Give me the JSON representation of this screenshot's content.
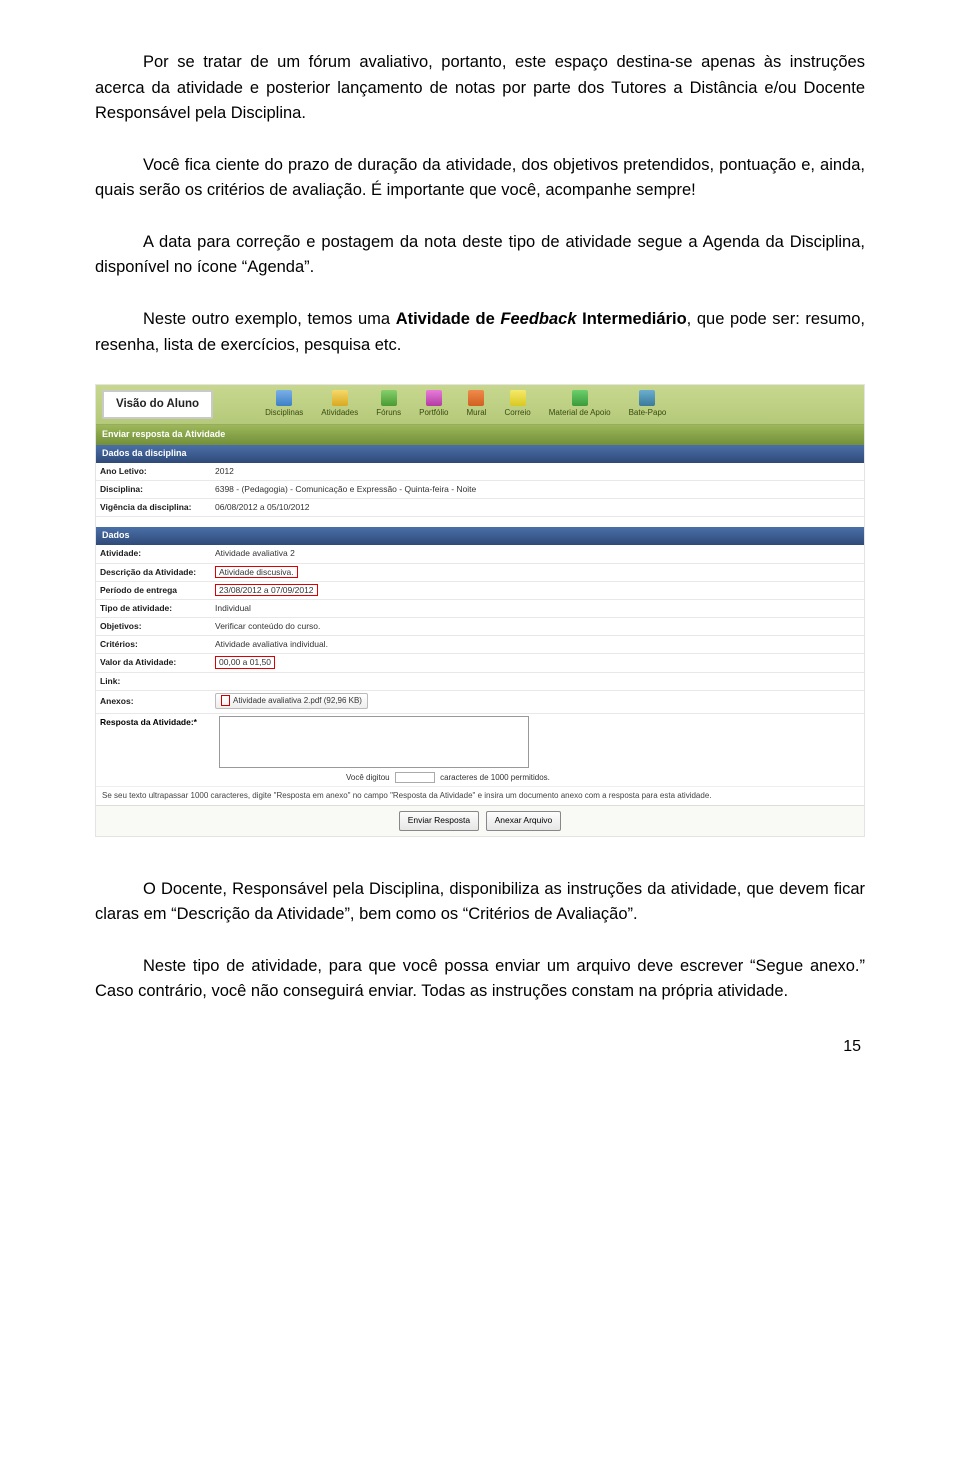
{
  "paragraphs": {
    "p1": "Por se tratar de um fórum avaliativo, portanto, este espaço destina-se apenas às instruções acerca da atividade e posterior lançamento de notas por parte dos Tutores a Distância e/ou Docente Responsável pela Disciplina.",
    "p2": "Você fica ciente do prazo de duração da atividade, dos objetivos pretendidos, pontuação e, ainda, quais serão os critérios de avaliação. É importante que você, acompanhe sempre!",
    "p3": "A data para correção e postagem da nota deste tipo de atividade segue a Agenda da Disciplina, disponível no ícone “Agenda”.",
    "p4_a": "Neste outro exemplo, temos uma ",
    "p4_b": "Atividade de ",
    "p4_c": "Feedback",
    "p4_d": " Intermediário",
    "p4_e": ", que pode ser: resumo, resenha, lista de exercícios, pesquisa etc.",
    "p5": "O Docente, Responsável pela Disciplina, disponibiliza as instruções da atividade, que devem ficar claras em “Descrição da Atividade”, bem como os “Critérios de Avaliação”.",
    "p6": "Neste tipo de atividade, para que você possa enviar um arquivo deve escrever “Segue anexo.” Caso contrário, você não conseguirá enviar. Todas as instruções constam na própria atividade."
  },
  "screenshot": {
    "visao": "Visão do Aluno",
    "nav": {
      "disciplinas": "Disciplinas",
      "atividades": "Atividades",
      "foruns": "Fóruns",
      "portfolio": "Portfólio",
      "mural": "Mural",
      "correio": "Correio",
      "material": "Material de Apoio",
      "batepapo": "Bate-Papo"
    },
    "section_enviar": "Enviar resposta da Atividade",
    "section_dados_disc": "Dados da disciplina",
    "ano_letivo_lbl": "Ano Letivo:",
    "ano_letivo_val": "2012",
    "disciplina_lbl": "Disciplina:",
    "disciplina_val": "6398 - (Pedagogia) - Comunicação e Expressão - Quinta-feira - Noite",
    "vigencia_lbl": "Vigência da disciplina:",
    "vigencia_val": "06/08/2012 a 05/10/2012",
    "section_dados": "Dados",
    "atividade_lbl": "Atividade:",
    "atividade_val": "Atividade avaliativa 2",
    "descricao_lbl": "Descrição da Atividade:",
    "descricao_val": "Atividade discusiva.",
    "periodo_lbl": "Período de entrega",
    "periodo_val": "23/08/2012 a 07/09/2012",
    "tipo_lbl": "Tipo de atividade:",
    "tipo_val": "Individual",
    "objetivos_lbl": "Objetivos:",
    "objetivos_val": "Verificar conteúdo do curso.",
    "criterios_lbl": "Critérios:",
    "criterios_val": "Atividade avaliativa individual.",
    "valor_lbl": "Valor da Atividade:",
    "valor_val": "00,00 a 01,50",
    "link_lbl": "Link:",
    "anexos_lbl": "Anexos:",
    "anexos_val": "Atividade avaliativa 2.pdf (92,96 KB)",
    "resposta_lbl": "Resposta da Atividade:*",
    "count_a": "Você digitou",
    "count_b": "caracteres de 1000 permitidos.",
    "hint": "Se seu texto ultrapassar 1000 caracteres, digite \"Resposta em anexo\" no campo \"Resposta da Atividade\" e insira um documento anexo com a resposta para esta atividade.",
    "btn_enviar": "Enviar Resposta",
    "btn_anexar": "Anexar Arquivo"
  },
  "pagenum": "15"
}
